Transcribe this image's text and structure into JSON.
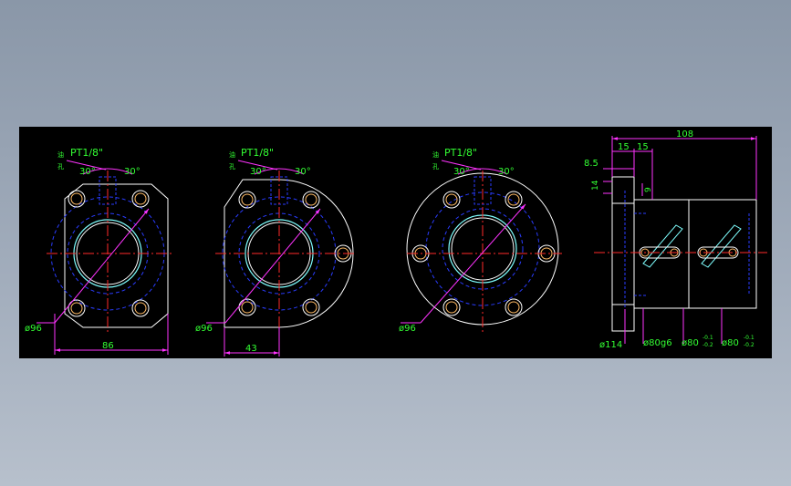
{
  "drawing": {
    "views": [
      {
        "id": "flange-a",
        "thread_label": "PT1/8\"",
        "angle_left": "30°",
        "angle_right": "30°",
        "diameter_label": "ø96",
        "width_label": "86"
      },
      {
        "id": "flange-b",
        "thread_label": "PT1/8\"",
        "angle_left": "30°",
        "angle_right": "30°",
        "diameter_label": "ø96",
        "width_label": "43"
      },
      {
        "id": "flange-c",
        "thread_label": "PT1/8\"",
        "angle_left": "30°",
        "angle_right": "30°",
        "diameter_label": "ø96"
      }
    ],
    "side_view": {
      "overall_length": "108",
      "dim_15a": "15",
      "dim_15b": "15",
      "dim_8_5": "8.5",
      "dim_14": "14",
      "dim_9": "9",
      "dia_114": "ø114",
      "dia_80g6": "ø80g6",
      "dia_80_a": "ø80",
      "tol_a_upper": "-0.1",
      "tol_a_lower": "-0.2",
      "dia_80_b": "ø80",
      "tol_b_upper": "-0.1",
      "tol_b_lower": "-0.2"
    },
    "colors": {
      "background": "#000000",
      "outline": "#ffffff",
      "hidden": "#2a3cff",
      "center": "#ff2a2a",
      "dimension": "#ff33ff",
      "text": "#33ff33",
      "thread": "#7fffff",
      "hole": "#ffbb66"
    }
  }
}
